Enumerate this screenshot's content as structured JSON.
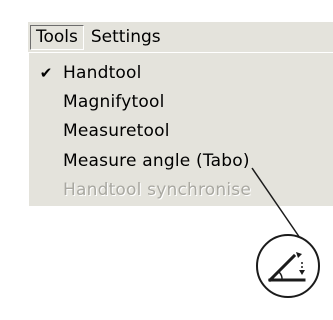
{
  "menubar": {
    "tools_label": "Tools",
    "settings_label": "Settings"
  },
  "dropdown": {
    "items": [
      {
        "label": "Handtool",
        "checked": true,
        "enabled": true
      },
      {
        "label": "Magnifytool",
        "checked": false,
        "enabled": true
      },
      {
        "label": "Measuretool",
        "checked": false,
        "enabled": true
      },
      {
        "label": "Measure angle (Tabo)",
        "checked": false,
        "enabled": true
      },
      {
        "label": "Handtool synchronise",
        "checked": false,
        "enabled": false
      }
    ],
    "check_glyph": "✔"
  },
  "callout": {
    "icon": "measure-angle-icon"
  },
  "colors": {
    "menu_background": "#e4e3dc",
    "disabled_text": "#a9a8a1",
    "text": "#000000"
  }
}
